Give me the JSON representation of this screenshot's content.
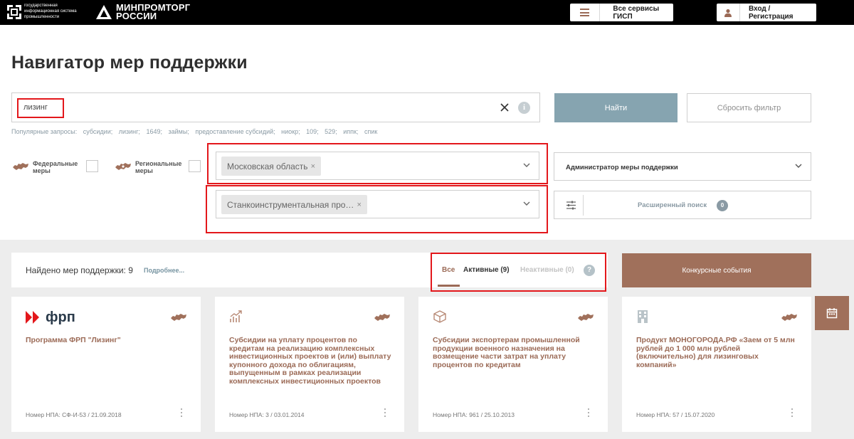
{
  "header": {
    "gisp_text": "государственная информационная система промышленности",
    "ministry_text_line1": "МИНПРОМТОРГ",
    "ministry_text_line2": "РОССИИ",
    "services_label": "Все сервисы ГИСП",
    "login_label": "Вход / Регистрация"
  },
  "page_title": "Навигатор мер поддержки",
  "search": {
    "value": "лизинг",
    "info_glyph": "i",
    "find_label": "Найти",
    "reset_label": "Сбросить фильтр"
  },
  "popular": {
    "label": "Популярные запросы:",
    "items": [
      "субсидии;",
      "лизинг;",
      "1649;",
      "займы;",
      "предоставление субсидий;",
      "ниокр;",
      "109;",
      "529;",
      "иппк;",
      "спик"
    ]
  },
  "filters": {
    "federal_label_1": "Федеральные",
    "federal_label_2": "меры",
    "regional_label_1": "Региональные",
    "regional_label_2": "меры",
    "region_chip": "Московская область",
    "industry_chip": "Станкоинструментальная про…",
    "chip_remove_glyph": "×",
    "admin_label": "Администратор меры поддержки",
    "advanced_label": "Расширенный поиск",
    "advanced_count": "0"
  },
  "results": {
    "found_text": "Найдено мер поддержки: 9",
    "more_link": "Подробнее...",
    "tab_all": "Все",
    "tab_active": "Активные (9)",
    "tab_inactive": "Неактивные (0)",
    "help_glyph": "?",
    "contest_label": "Конкурсные события"
  },
  "cards": [
    {
      "logo_text": "фрп",
      "title": "Программа ФРП \"Лизинг\"",
      "npa": "Номер НПА: СФ-И-53 / 21.09.2018"
    },
    {
      "title": "Субсидии на уплату процентов по кредитам на реализацию комплексных инвестиционных проектов и (или) выплату купонного дохода по облигациям, выпущенным в рамках реализации комплексных инвестиционных проектов",
      "npa": "Номер НПА: 3 / 03.01.2014"
    },
    {
      "title": "Субсидии экспортерам промышленной продукции военного назначения на возмещение части затрат на уплату процентов по кредитам",
      "npa": "Номер НПА: 961 / 25.10.2013"
    },
    {
      "title": "Продукт МОНОГОРОДА.РФ «Заем от 5 млн рублей до 1 000 млн рублей (включительно) для лизинговых компаний»",
      "npa": "Номер НПА: 57 / 15.07.2020"
    }
  ],
  "colors": {
    "brand_brown": "#9b6a56",
    "find_button": "#86a4b0",
    "highlight_red": "#e3171b",
    "header_bg": "#000000",
    "results_bg": "#ededed"
  },
  "icons": [
    "gisp-logo-icon",
    "ministry-logo-icon",
    "menu-icon",
    "user-icon",
    "close-icon",
    "info-icon",
    "russia-map-icon",
    "chevron-down-icon",
    "sliders-icon",
    "help-icon",
    "frp-logo-icon",
    "growth-chart-icon",
    "box-icon",
    "building-icon",
    "more-vertical-icon",
    "calendar-icon"
  ]
}
